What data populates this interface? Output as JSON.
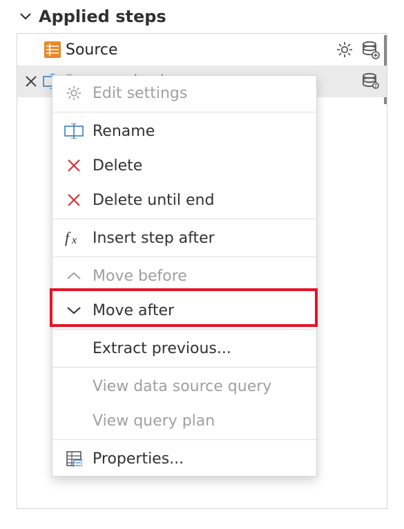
{
  "panel": {
    "title": "Applied steps"
  },
  "steps": [
    {
      "label": "Source"
    },
    {
      "label": "Renamed columns"
    }
  ],
  "menu": {
    "edit_settings": "Edit settings",
    "rename": "Rename",
    "delete": "Delete",
    "delete_until_end": "Delete until end",
    "insert_step_after": "Insert step after",
    "move_before": "Move before",
    "move_after": "Move after",
    "extract_previous": "Extract previous...",
    "view_data_source_query": "View data source query",
    "view_query_plan": "View query plan",
    "properties": "Properties..."
  }
}
